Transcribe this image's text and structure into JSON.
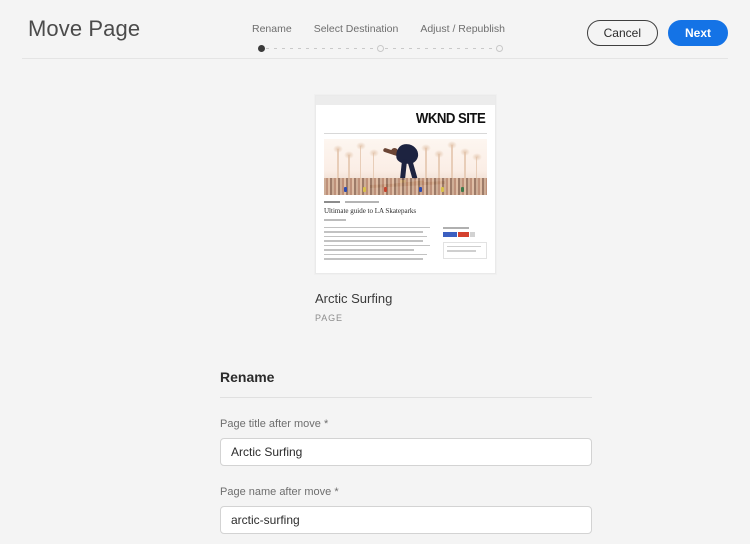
{
  "header": {
    "title": "Move Page",
    "steps": [
      {
        "label": "Rename",
        "state": "active"
      },
      {
        "label": "Select Destination",
        "state": "inactive"
      },
      {
        "label": "Adjust / Republish",
        "state": "inactive"
      }
    ],
    "cancel_label": "Cancel",
    "next_label": "Next",
    "accent_color": "#1473e6"
  },
  "card": {
    "title": "Arctic Surfing",
    "type_label": "PAGE",
    "preview": {
      "site_logo": "WKND SITE",
      "article_heading": "Ultimate guide to LA Skateparks"
    }
  },
  "form": {
    "heading": "Rename",
    "fields": [
      {
        "label": "Page title after move *",
        "value": "Arctic Surfing",
        "placeholder": "Page title after move"
      },
      {
        "label": "Page name after move *",
        "value": "arctic-surfing",
        "placeholder": "Page name after move"
      }
    ]
  }
}
